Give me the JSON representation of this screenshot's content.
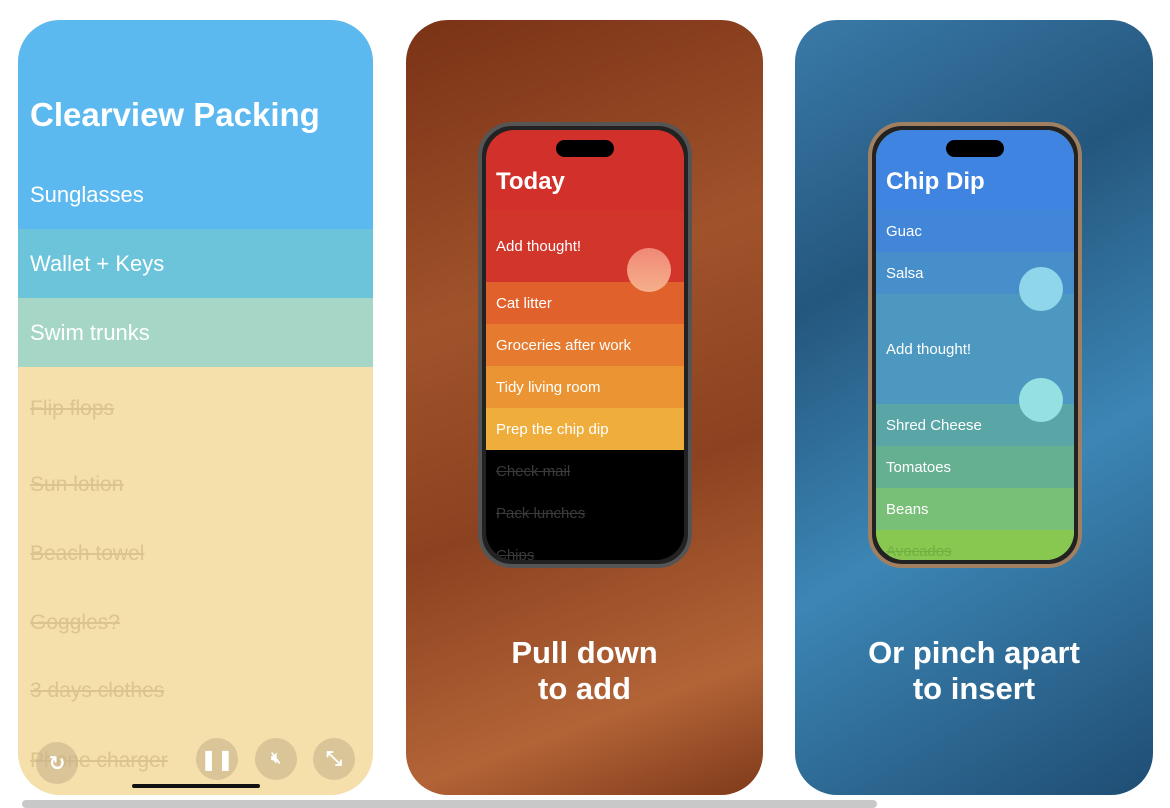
{
  "panel1": {
    "title": "Clearview Packing",
    "active_items": [
      {
        "label": "Sunglasses",
        "color": "#5cb9ef"
      },
      {
        "label": "Wallet + Keys",
        "color": "#6cc4db"
      },
      {
        "label": "Swim trunks",
        "color": "#a6d6c6"
      }
    ],
    "done_items": [
      "Flip flops",
      "Sun lotion",
      "Beach towel",
      "Goggles?",
      "3 days clothes",
      "Phone charger"
    ],
    "controls": {
      "replay": "replay-icon",
      "pause": "pause-icon",
      "mute": "muted-speaker-icon",
      "fullscreen": "expand-icon"
    }
  },
  "panel2": {
    "list_title": "Today",
    "items": [
      {
        "label": "Add thought!",
        "color": "#d2352a"
      },
      {
        "label": "Cat litter",
        "color": "#e0612b"
      },
      {
        "label": "Groceries after work",
        "color": "#e67a2e"
      },
      {
        "label": "Tidy living room",
        "color": "#eb9434"
      },
      {
        "label": "Prep the chip dip",
        "color": "#efad3c"
      }
    ],
    "done_items": [
      "Check mail",
      "Pack lunches",
      "Chips"
    ],
    "caption_line1": "Pull down",
    "caption_line2": "to add"
  },
  "panel3": {
    "list_title": "Chip Dip",
    "items": [
      {
        "label": "Guac",
        "color": "#4186d8"
      },
      {
        "label": "Salsa",
        "color": "#478fcb"
      },
      {
        "label": "Add thought!",
        "color": "#4c98c0"
      },
      {
        "label": "Shred Cheese",
        "color": "#5aa5a6"
      },
      {
        "label": "Tomatoes",
        "color": "#66b092"
      },
      {
        "label": "Beans",
        "color": "#78bf77"
      }
    ],
    "done_items": [
      "Avocados"
    ],
    "caption_line1": "Or pinch apart",
    "caption_line2": "to insert"
  }
}
